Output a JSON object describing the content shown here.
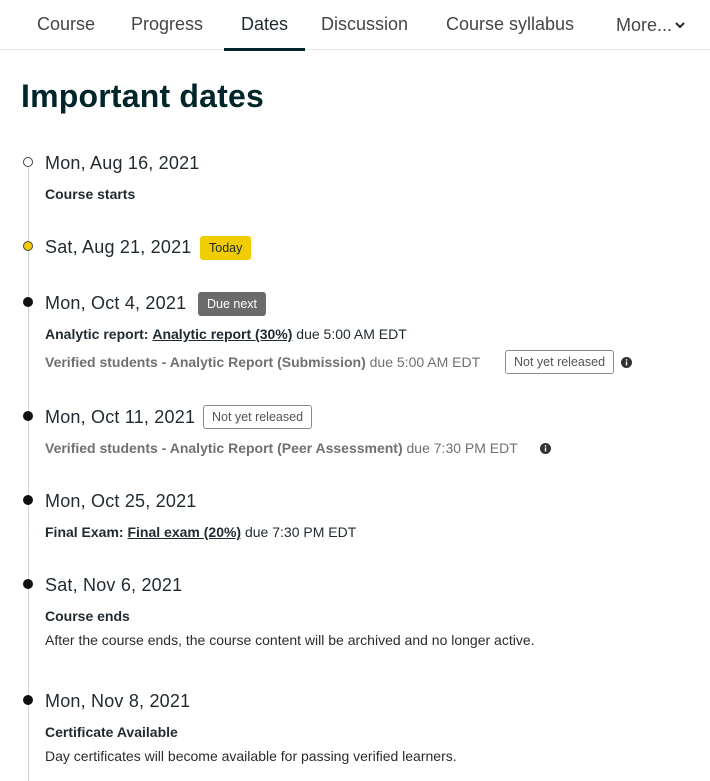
{
  "nav": {
    "tabs": [
      {
        "label": "Course"
      },
      {
        "label": "Progress"
      },
      {
        "label": "Dates",
        "active": true
      },
      {
        "label": "Discussion"
      },
      {
        "label": "Course syllabus"
      },
      {
        "label": "More..."
      }
    ]
  },
  "page": {
    "title": "Important dates"
  },
  "events": [
    {
      "date": "Mon, Aug 16, 2021",
      "title": "Course starts"
    },
    {
      "date": "Sat, Aug 21, 2021",
      "badge": "Today"
    },
    {
      "date": "Mon, Oct 4, 2021",
      "badge": "Due next",
      "item1": {
        "prefix": "Analytic report:",
        "link": "Analytic report (30%)",
        "due": "due 5:00 AM EDT"
      },
      "item2": {
        "title": "Verified students - Analytic Report (Submission)",
        "due": "due 5:00 AM EDT",
        "badge": "Not yet released"
      }
    },
    {
      "date": "Mon, Oct 11, 2021",
      "badge": "Not yet released",
      "item1": {
        "title": "Verified students - Analytic Report (Peer Assessment)",
        "due": "due 7:30 PM EDT"
      }
    },
    {
      "date": "Mon, Oct 25, 2021",
      "item1": {
        "prefix": "Final Exam:",
        "link": "Final exam (20%)",
        "due": "due 7:30 PM EDT"
      }
    },
    {
      "date": "Sat, Nov 6, 2021",
      "title": "Course ends",
      "description": "After the course ends, the course content will be archived and no longer active."
    },
    {
      "date": "Mon, Nov 8, 2021",
      "title": "Certificate Available",
      "description": "Day certificates will become available for passing verified learners."
    }
  ],
  "colors": {
    "accent": "#00262b",
    "today": "#f0cc00",
    "due_next": "#6b6b6b"
  },
  "icons": {
    "more": "chevron-down-icon",
    "info": "info-icon"
  }
}
